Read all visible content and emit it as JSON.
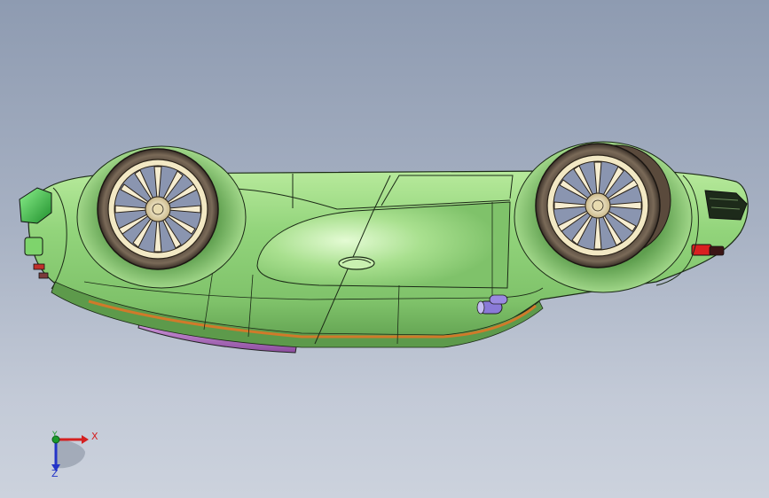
{
  "viewport": {
    "background_top": "#8e9bb1",
    "background_bottom": "#ccd2dd"
  },
  "model": {
    "body_color": "#8fd27a",
    "body_highlight": "#c9f0b0",
    "body_shadow": "#5e9e4e",
    "side_skirt_color": "#b06fc0",
    "pinstripe_color": "#d07a2a",
    "exhaust_color": "#8a7ad8",
    "wheel_rim_color": "#efe3bb",
    "tire_color": "#6a5a4a",
    "front_bumper_color": "#2fbf3f",
    "taillight_color": "#d92020"
  },
  "triad": {
    "x_label": "X",
    "y_label": "Y",
    "z_label": "Z",
    "x_color": "#d42020",
    "y_color": "#1a9a2a",
    "z_color": "#2434c8"
  }
}
